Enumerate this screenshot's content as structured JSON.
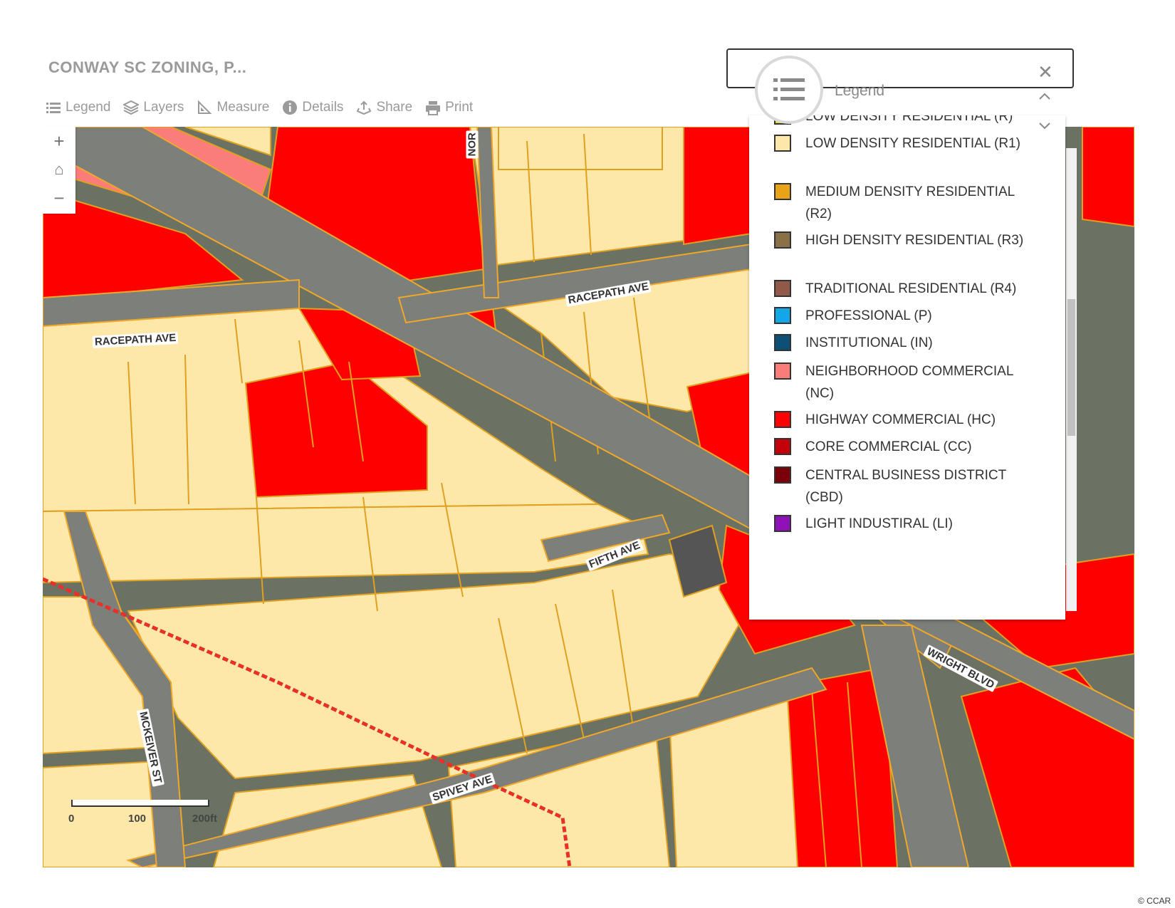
{
  "app": {
    "title": "CONWAY SC ZONING, P..."
  },
  "toolbar": [
    {
      "label": "Legend",
      "icon": "list-icon"
    },
    {
      "label": "Layers",
      "icon": "layers-icon"
    },
    {
      "label": "Measure",
      "icon": "ruler-icon"
    },
    {
      "label": "Details",
      "icon": "info-icon"
    },
    {
      "label": "Share",
      "icon": "share-icon"
    },
    {
      "label": "Print",
      "icon": "printer-icon"
    }
  ],
  "zoom": {
    "in": "+",
    "home": "⌂",
    "out": "−"
  },
  "streets": {
    "racepath_1": "RACEPATH AVE",
    "racepath_2": "RACEPATH AVE",
    "fifth": "FIFTH AVE",
    "mckeiver": "MCKEIVER ST",
    "spivey": "SPIVEY AVE",
    "wright": "WRIGHT BLVD",
    "north_partial": "NOR"
  },
  "scale": {
    "zero": "0",
    "mid": "100",
    "end": "200ft"
  },
  "legend": {
    "title": "Legend",
    "partial_top": "LOW DENSITY RESIDENTIAL (R)",
    "items": [
      {
        "label": "LOW DENSITY RESIDENTIAL (R1)",
        "color": "#fde8aa"
      },
      {
        "label": "MEDIUM DENSITY RESIDENTIAL (R2)",
        "color": "#e8a318"
      },
      {
        "label": "HIGH DENSITY RESIDENTIAL (R3)",
        "color": "#8a7047"
      },
      {
        "label": "TRADITIONAL RESIDENTIAL (R4)",
        "color": "#915a48"
      },
      {
        "label": "PROFESSIONAL (P)",
        "color": "#14a7e8"
      },
      {
        "label": "INSTITUTIONAL (IN)",
        "color": "#0d4f75"
      },
      {
        "label": "NEIGHBORHOOD COMMERCIAL (NC)",
        "color": "#fa7d7a"
      },
      {
        "label": "HIGHWAY COMMERCIAL (HC)",
        "color": "#ff0000"
      },
      {
        "label": "CORE COMMERCIAL (CC)",
        "color": "#c4000b"
      },
      {
        "label": "CENTRAL BUSINESS DISTRICT (CBD)",
        "color": "#7c0008"
      },
      {
        "label": "LIGHT INDUSTIRAL (LI)",
        "color": "#8e12b8"
      }
    ]
  },
  "credit": "© CCAR"
}
